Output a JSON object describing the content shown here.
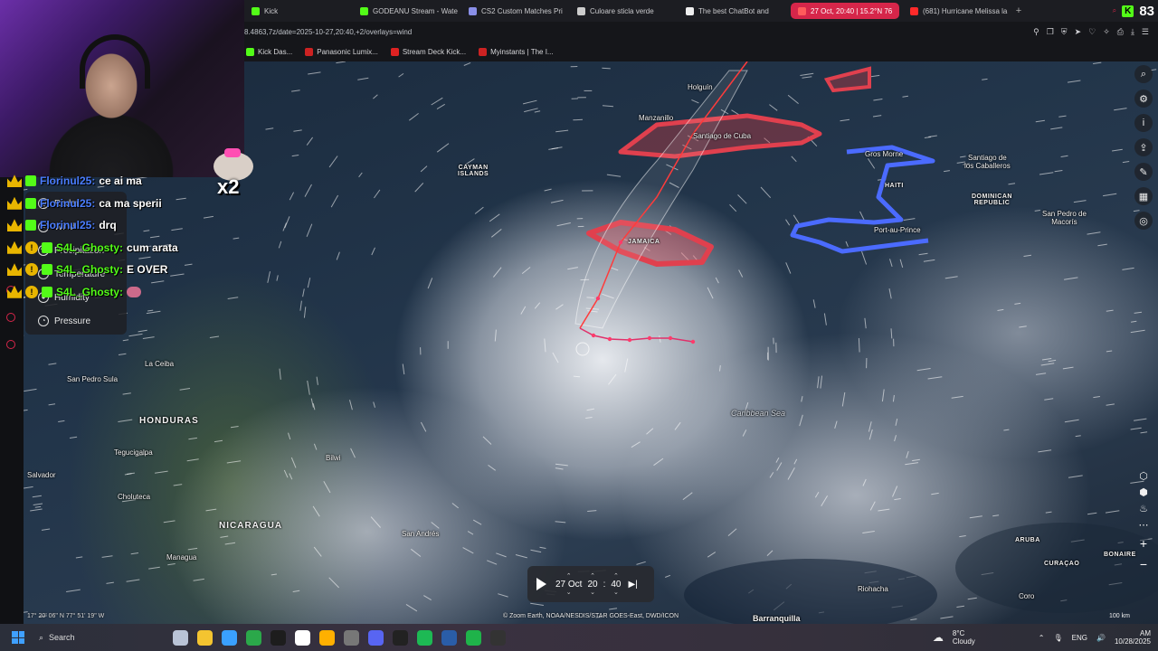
{
  "browser": {
    "tabs": [
      {
        "title": "Kick",
        "color": "#53fc18"
      },
      {
        "title": "GODEANU Stream - Wate",
        "color": "#53fc18"
      },
      {
        "title": "CS2 Custom Matches Pri",
        "color": "#8a8fe8"
      },
      {
        "title": "Culoare sticla verde",
        "color": "#cccccc"
      },
      {
        "title": "The best ChatBot and",
        "color": "#eeeeee"
      },
      {
        "title": "27 Oct, 20:40 | 15.2°N 76",
        "color": "#ff5b5b",
        "active": true
      },
      {
        "title": "(681) Hurricane Melissa la",
        "color": "#ff2a2a"
      }
    ],
    "new_tab": "+",
    "kick_badge": "K",
    "kick_count": "83",
    "url": "8.4863,7z/date=2025-10-27,20:40,+2/overlays=wind",
    "bookmarks": [
      {
        "label": "Kick Das...",
        "color": "#53fc18"
      },
      {
        "label": "Panasonic Lumix...",
        "color": "#cc2222"
      },
      {
        "label": "Stream Deck Kick...",
        "color": "#dd2222"
      },
      {
        "label": "Myinstants | The I...",
        "color": "#cc2222"
      }
    ]
  },
  "layers_panel": {
    "items": [
      {
        "label": "Radar",
        "icon": "radar-icon",
        "glyph": "◎"
      },
      {
        "label": "Wind",
        "icon": "wind-icon",
        "glyph": "≈"
      },
      {
        "label": "Precipitation",
        "icon": "rain-icon",
        "glyph": "☂"
      },
      {
        "label": "Temperature",
        "icon": "thermometer-icon",
        "glyph": "°"
      },
      {
        "label": "Humidity",
        "icon": "droplet-icon",
        "glyph": "●"
      },
      {
        "label": "Pressure",
        "icon": "gauge-icon",
        "glyph": "◔"
      }
    ]
  },
  "chat": [
    {
      "crown": true,
      "mod": false,
      "user": "Florinul25:",
      "message": "ce ai ma",
      "user_color": "blue"
    },
    {
      "crown": true,
      "mod": false,
      "user": "Florinul25:",
      "message": "ca ma sperii",
      "user_color": "blue"
    },
    {
      "crown": true,
      "mod": false,
      "user": "Florinul25:",
      "message": "drq",
      "user_color": "blue"
    },
    {
      "crown": true,
      "mod": true,
      "user": "S4L_Ghosty:",
      "message": "cum arata",
      "user_color": "green"
    },
    {
      "crown": true,
      "mod": true,
      "user": "S4L_Ghosty:",
      "message": "E OVER",
      "user_color": "green"
    },
    {
      "crown": true,
      "mod": true,
      "user": "S4L_Ghosty:",
      "message": "",
      "user_color": "green"
    }
  ],
  "sticker_text": "x2",
  "map": {
    "places": [
      {
        "name": "CAYMAN\nISLANDS",
        "kind": "small-caps"
      },
      {
        "name": "JAMAICA",
        "kind": "small-caps"
      },
      {
        "name": "HAITI",
        "kind": "small-caps"
      },
      {
        "name": "DOMINICAN\nREPUBLIC",
        "kind": "small-caps"
      },
      {
        "name": "HONDURAS",
        "kind": "country"
      },
      {
        "name": "NICARAGUA",
        "kind": "country"
      },
      {
        "name": "Caribbean Sea",
        "kind": "sea"
      },
      {
        "name": "Holguín",
        "kind": "city"
      },
      {
        "name": "Manzanillo",
        "kind": "city"
      },
      {
        "name": "Santiago de Cuba",
        "kind": "city"
      },
      {
        "name": "Gros Morne",
        "kind": "city"
      },
      {
        "name": "Santiago de\nlos Caballeros",
        "kind": "city"
      },
      {
        "name": "San Pedro de\nMacorís",
        "kind": "city"
      },
      {
        "name": "Port-au-Prince",
        "kind": "city"
      },
      {
        "name": "La Ceiba",
        "kind": "city"
      },
      {
        "name": "San Pedro Sula",
        "kind": "city"
      },
      {
        "name": "Tegucigalpa",
        "kind": "city"
      },
      {
        "name": "Salvador",
        "kind": "city"
      },
      {
        "name": "Choluteca",
        "kind": "city"
      },
      {
        "name": "Managua",
        "kind": "city"
      },
      {
        "name": "San Andrés",
        "kind": "city"
      },
      {
        "name": "Bilwi",
        "kind": "city"
      },
      {
        "name": "ARUBA",
        "kind": "small-caps"
      },
      {
        "name": "CURAÇAO",
        "kind": "small-caps"
      },
      {
        "name": "BONAIRE",
        "kind": "small-caps"
      },
      {
        "name": "Riohacha",
        "kind": "city"
      },
      {
        "name": "Coro",
        "kind": "city"
      },
      {
        "name": "Barranquilla",
        "kind": "city"
      }
    ],
    "attribution": "© Zoom Earth, NOAA/NESDIS/STAR GOES-East, DWD/ICON",
    "coords": "17° 20' 06\" N   77° 51' 19\" W",
    "scale": "100 km"
  },
  "time_control": {
    "date": "27 Oct",
    "hour": "20",
    "separator": ":",
    "minute": "40"
  },
  "map_tools": [
    {
      "icon": "search-icon",
      "glyph": "⌕"
    },
    {
      "icon": "settings-icon",
      "glyph": "⚙"
    },
    {
      "icon": "info-icon",
      "glyph": "i"
    },
    {
      "icon": "share-icon",
      "glyph": "⇪"
    },
    {
      "icon": "draw-icon",
      "glyph": "✎"
    },
    {
      "icon": "grid-icon",
      "glyph": "▦"
    },
    {
      "icon": "locate-icon",
      "glyph": "◎"
    }
  ],
  "map_tools_lower": [
    {
      "icon": "layers-a-icon",
      "glyph": "⬡"
    },
    {
      "icon": "layers-b-icon",
      "glyph": "⬢"
    },
    {
      "icon": "fire-icon",
      "glyph": "♨"
    },
    {
      "icon": "more-icon",
      "glyph": "⋯"
    }
  ],
  "zoom": {
    "in": "+",
    "out": "−"
  },
  "taskbar": {
    "search_label": "Search",
    "weather_temp": "8°C",
    "weather_desc": "Cloudy",
    "lang": "ENG",
    "time": "AM",
    "date": "10/28/2025",
    "apps": [
      "#b9c3d6",
      "#f4c430",
      "#3aa0ff",
      "#2ba84a",
      "#1d1d1d",
      "#ffffff",
      "#ffb000",
      "#777777",
      "#5865f2",
      "#222222",
      "#1db954",
      "#2a5da8",
      "#1fb34a",
      "#333333"
    ]
  }
}
